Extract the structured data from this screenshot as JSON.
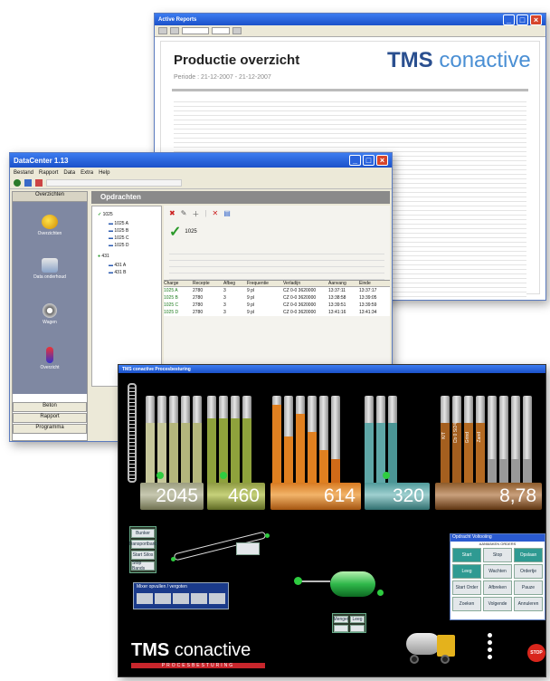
{
  "report": {
    "title": "Productie overzicht",
    "period": "Periode : 21-12-2007 - 21-12-2007",
    "logo": {
      "part1": "TMS",
      "part2": "conactive"
    }
  },
  "batch": {
    "title": "DataCenter 1.13",
    "menu": [
      "Bestand",
      "Rapport",
      "Data",
      "Extra",
      "Help"
    ],
    "sidebar": {
      "header": "Overzichten"
    },
    "panel_header": "Opdrachten",
    "sidebar_items": [
      "Overzichten",
      "Data onderhoud",
      "Wagen",
      "Overzicht"
    ],
    "bottom_nav": [
      "Beton",
      "Rapport",
      "Programma"
    ],
    "tree_items": [
      "1025",
      "1025 A",
      "1025 B",
      "1025 C",
      "1025 D",
      "431",
      "431 A",
      "431 B"
    ],
    "status": "1025",
    "table_headers": [
      "Charge",
      "Recepte",
      "Afbeg",
      "Frequentie",
      "Verladijn",
      "Aanvang",
      "Einde"
    ],
    "rows": [
      [
        "1025 A",
        "2780",
        "3",
        "9 pl",
        "CZ 0-0 3620000",
        "13:37:11",
        "13:37:17"
      ],
      [
        "1025 B",
        "2780",
        "3",
        "9 pl",
        "CZ 0-0 3620000",
        "13:38:58",
        "13:39:05"
      ],
      [
        "1025 C",
        "2780",
        "3",
        "9 pl",
        "CZ 0-0 3620000",
        "13:39:51",
        "13:39:59"
      ],
      [
        "1025 D",
        "2780",
        "3",
        "9 pl",
        "CZ 0-0 3620000",
        "13:41:16",
        "13:41:34"
      ]
    ]
  },
  "plant": {
    "title": "TMS conactive Procesbesturing",
    "displays": [
      "2045",
      "460",
      "614",
      "320",
      "8,78"
    ],
    "silo_labels": [
      "K/T",
      "Cb 0 S/24",
      "Grind",
      "Zand"
    ],
    "left_buttons": [
      "Bunker",
      "Transportband",
      "Start Silos",
      "Stop Bands"
    ],
    "mid_buttons": [
      "Menger",
      "Leeg"
    ],
    "small_panel": "Mixer opvullen / vergoten",
    "right_panel": {
      "title": "Opdracht Voltooiing",
      "subtitle": "AANMAKEN ORDERS",
      "buttons": [
        "Start",
        "Stop",
        "Opslaan",
        "Leeg",
        "Wachten",
        "Ordertje",
        "Start Order",
        "Afbreken",
        "Pauze",
        "Zoeken",
        "Volgende",
        "Annuleren"
      ]
    },
    "logo": {
      "part1": "TMS",
      "part2": "conactive",
      "tagline": "PROCESBESTURING"
    },
    "stop_label": "STOP"
  }
}
